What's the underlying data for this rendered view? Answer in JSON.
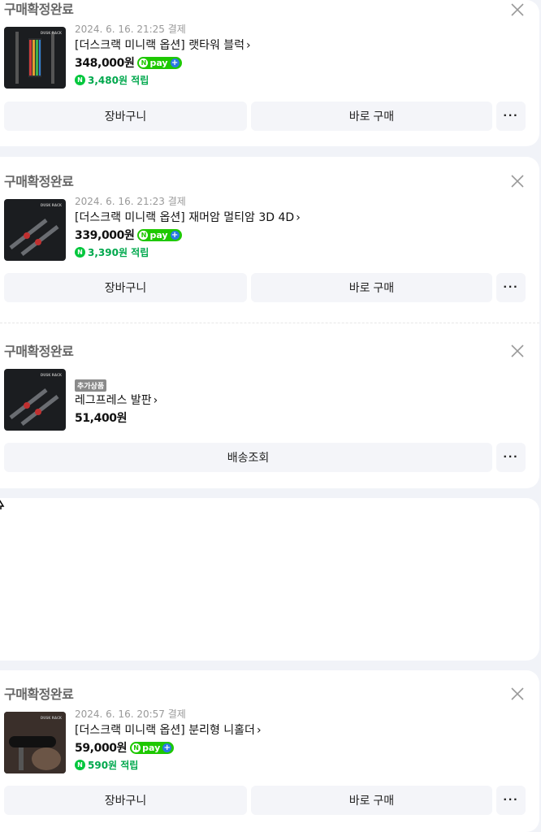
{
  "orders": [
    {
      "status": "구매확정완료",
      "date": "2024. 6. 16. 21:25 결제",
      "name": "[더스크랙 미니랙 옵션] 랫타워 블럭",
      "price": "348,000원",
      "points": "3,480원 적립",
      "cart_label": "장바구니",
      "buy_label": "바로 구매"
    },
    {
      "status": "구매확정완료",
      "date": "2024. 6. 16. 21:23 결제",
      "name": "[더스크랙 미니랙 옵션] 재머암 멀티암 3D 4D",
      "price": "339,000원",
      "points": "3,390원 적립",
      "cart_label": "장바구니",
      "buy_label": "바로 구매"
    },
    {
      "status": "구매확정완료",
      "tag": "추가상품",
      "name": "레그프레스 발판",
      "price": "51,400원",
      "track_label": "배송조회"
    },
    {
      "status": "구매확정완료",
      "date": "2024. 6. 16. 20:57 결제",
      "name": "[더스크랙 미니랙 옵션] 분리형 니홀더",
      "price": "59,000원",
      "points": "590원 적립",
      "cart_label": "장바구니",
      "buy_label": "바로 구매"
    }
  ],
  "npay_label": "pay",
  "more_label": "···",
  "thumb_brand": "DUSK RACK",
  "colors": {
    "points": "#00a84d",
    "npay": "#1ec800"
  },
  "icons": {
    "close": "close-icon",
    "chevron": "chevron-right-icon",
    "more": "more-icon"
  }
}
